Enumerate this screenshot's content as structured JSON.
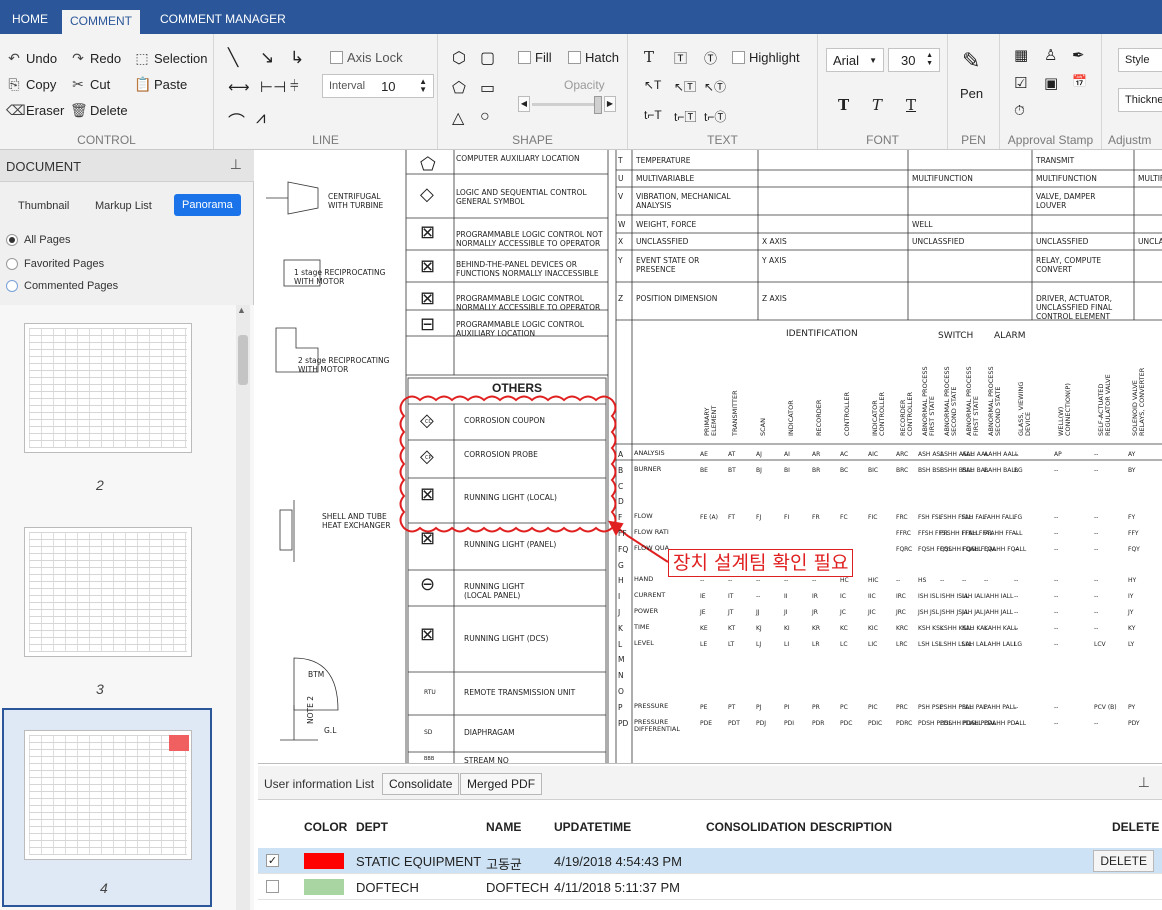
{
  "tabs": [
    "HOME",
    "COMMENT",
    "COMMENT MANAGER"
  ],
  "active_tab": "COMMENT",
  "ribbon": {
    "control": {
      "title": "CONTROL",
      "undo": "Undo",
      "redo": "Redo",
      "selection": "Selection",
      "copy": "Copy",
      "cut": "Cut",
      "paste": "Paste",
      "eraser": "Eraser",
      "delete": "Delete"
    },
    "line": {
      "title": "LINE",
      "axis_lock": "Axis Lock",
      "interval_label": "Interval",
      "interval_value": "10"
    },
    "shape": {
      "title": "SHAPE",
      "fill": "Fill",
      "hatch": "Hatch",
      "opacity": "Opacity"
    },
    "text": {
      "title": "TEXT",
      "highlight": "Highlight"
    },
    "font": {
      "title": "FONT",
      "family": "Arial",
      "size": "30"
    },
    "pen": {
      "title": "PEN",
      "label": "Pen"
    },
    "approval": {
      "title": "Approval Stamp"
    },
    "adjust": {
      "title": "Adjustm",
      "style": "Style",
      "thickness": "Thicknes"
    }
  },
  "document_panel": {
    "title": "DOCUMENT",
    "subtabs": [
      "Thumbnail",
      "Markup List",
      "Panorama"
    ],
    "active_subtab": "Panorama",
    "filters": [
      "All Pages",
      "Favorited Pages",
      "Commented Pages"
    ],
    "selected_filter": "All Pages",
    "pages": [
      "2",
      "3",
      "4"
    ]
  },
  "drawing": {
    "equipment_labels": [
      "CENTRIFUGAL\nWITH TURBINE",
      "1 stage RECIPROCATING\nWITH MOTOR",
      "2 stage RECIPROCATING\nWITH MOTOR",
      "SHELL AND TUBE\nHEAT EXCHANGER",
      "BTM",
      "NOTE 2",
      "G.L"
    ],
    "symbol_rows": [
      "COMPUTER AUXILIARY LOCATION",
      "LOGIC AND SEQUENTIAL CONTROL\nGENERAL SYMBOL",
      "PROGRAMMABLE LOGIC CONTROL NOT\nNORMALLY ACCESSIBLE TO OPERATOR",
      "BEHIND-THE-PANEL DEVICES OR\nFUNCTIONS NORMALLY INACCESSIBLE",
      "PROGRAMMABLE LOGIC CONTROL\nNORMALLY ACCESSIBLE TO OPERATOR",
      "PROGRAMMABLE LOGIC CONTROL\nAUXILIARY LOCATION"
    ],
    "others_title": "OTHERS",
    "others_rows": [
      "CORROSION COUPON",
      "CORROSION PROBE",
      "RUNNING LIGHT (LOCAL)",
      "RUNNING LIGHT (PANEL)",
      "RUNNING LIGHT\n(LOCAL PANEL)",
      "RUNNING LIGHT (DCS)",
      "REMOTE TRANSMISSION UNIT",
      "DIAPHRAGAM",
      "STREAM NO"
    ],
    "others_symbols": [
      "CC",
      "CP",
      "RTU",
      "SD",
      "BBB"
    ],
    "letter_rows": [
      {
        "letter": "T",
        "first": "TEMPERATURE",
        "c3": "",
        "c4": "",
        "c5": "TRANSMIT",
        "c6": ""
      },
      {
        "letter": "U",
        "first": "MULTIVARIABLE",
        "c3": "",
        "c4": "MULTIFUNCTION",
        "c5": "MULTIFUNCTION",
        "c6": "MULTIF"
      },
      {
        "letter": "V",
        "first": "VIBRATION, MECHANICAL\nANALYSIS",
        "c3": "",
        "c4": "",
        "c5": "VALVE, DAMPER\nLOUVER",
        "c6": ""
      },
      {
        "letter": "W",
        "first": "WEIGHT, FORCE",
        "c3": "",
        "c4": "WELL",
        "c5": "",
        "c6": ""
      },
      {
        "letter": "X",
        "first": "UNCLASSFIED",
        "c3": "X AXIS",
        "c4": "UNCLASSFIED",
        "c5": "UNCLASSFIED",
        "c6": "UNCLA"
      },
      {
        "letter": "Y",
        "first": "EVENT STATE OR\nPRESENCE",
        "c3": "Y AXIS",
        "c4": "",
        "c5": "RELAY, COMPUTE\nCONVERT",
        "c6": ""
      },
      {
        "letter": "Z",
        "first": "POSITION DIMENSION",
        "c3": "Z AXIS",
        "c4": "",
        "c5": "DRIVER, ACTUATOR,\nUNCLASSFIED FINAL\nCONTROL ELEMENT",
        "c6": ""
      }
    ],
    "ident_header": "IDENTIFICATION",
    "switch_header": "SWITCH",
    "alarm_header": "ALARM",
    "ident_columns": [
      "PRIMARY\nELEMENT",
      "TRANSMITTER",
      "SCAN",
      "INDICATOR",
      "RECORDER",
      "CONTROLLER",
      "INDICATOR\nCONTROLLER",
      "RECORDER\nCONTROLLER",
      "ABNORMAL PROCESS\nFIRST STATE",
      "ABNORMAL PROCESS\nSECOND STATE",
      "ABNORMAL PROCESS\nFIRST STATE",
      "ABNORMAL PROCESS\nSECOND STATE",
      "GLASS, VIEWING\nDEVICE",
      "WELL(W)\nCONNECTION(P)",
      "SELF-ACTUATED\nREGULATOR VALVE",
      "SOLENOID VALVE\nRELAYS, CONVERTER"
    ],
    "ident_rows": [
      {
        "letter": "A",
        "name": "ANALYSIS",
        "vals": [
          "AE",
          "AT",
          "AJ",
          "AI",
          "AR",
          "AC",
          "AIC",
          "ARC",
          "ASH ASL",
          "ASHH ASLL",
          "AAH AAL",
          "AAHH AALL",
          "--",
          "AP",
          "--",
          "AY"
        ]
      },
      {
        "letter": "B",
        "name": "BURNER",
        "vals": [
          "BE",
          "BT",
          "BJ",
          "BI",
          "BR",
          "BC",
          "BIC",
          "BRC",
          "BSH BSL",
          "BSHH BSLL",
          "BAH BAL",
          "BAHH BALL",
          "BG",
          "--",
          "--",
          "BY"
        ]
      },
      {
        "letter": "C",
        "name": "",
        "vals": []
      },
      {
        "letter": "D",
        "name": "",
        "vals": []
      },
      {
        "letter": "F",
        "name": "FLOW",
        "vals": [
          "FE (A)",
          "FT",
          "FJ",
          "FI",
          "FR",
          "FC",
          "FIC",
          "FRC",
          "FSH FSL",
          "FSHH FSLL",
          "FAH FAL",
          "FAHH FALL",
          "FG",
          "--",
          "--",
          "FY"
        ]
      },
      {
        "letter": "FF",
        "name": "FLOW RATI",
        "vals": [
          "",
          "",
          "",
          "",
          "",
          "",
          "",
          "FFRC",
          "FFSH FFSL",
          "FFSHH FFSLL",
          "FFAH FFAL",
          "FFAHH FFALL",
          "--",
          "--",
          "--",
          "FFY"
        ]
      },
      {
        "letter": "FQ",
        "name": "FLOW QUA",
        "vals": [
          "",
          "",
          "",
          "",
          "",
          "",
          "",
          "FQRC",
          "FQSH FQSL",
          "FQSHH FQSLL",
          "FQAH FQAL",
          "FQAHH FQALL",
          "--",
          "--",
          "--",
          "FQY"
        ]
      },
      {
        "letter": "G",
        "name": "",
        "vals": []
      },
      {
        "letter": "H",
        "name": "HAND",
        "vals": [
          "--",
          "--",
          "--",
          "--",
          "--",
          "HC",
          "HIC",
          "--",
          "HS",
          "--",
          "--",
          "--",
          "--",
          "--",
          "--",
          "HY"
        ]
      },
      {
        "letter": "I",
        "name": "CURRENT",
        "vals": [
          "IE",
          "IT",
          "--",
          "II",
          "IR",
          "IC",
          "IIC",
          "IRC",
          "ISH ISL",
          "ISHH ISLL",
          "IAH IAL",
          "IAHH IALL",
          "--",
          "--",
          "--",
          "IY"
        ]
      },
      {
        "letter": "J",
        "name": "POWER",
        "vals": [
          "JE",
          "JT",
          "JJ",
          "JI",
          "JR",
          "JC",
          "JIC",
          "JRC",
          "JSH JSL",
          "JSHH JSLL",
          "JAH JAL",
          "JAHH JALL",
          "--",
          "--",
          "--",
          "JY"
        ]
      },
      {
        "letter": "K",
        "name": "TIME",
        "vals": [
          "KE",
          "KT",
          "KJ",
          "KI",
          "KR",
          "KC",
          "KIC",
          "KRC",
          "KSH KSL",
          "KSHH KSLL",
          "KAH KAL",
          "KAHH KALL",
          "--",
          "--",
          "--",
          "KY"
        ]
      },
      {
        "letter": "L",
        "name": "LEVEL",
        "vals": [
          "LE",
          "LT",
          "LJ",
          "LI",
          "LR",
          "LC",
          "LIC",
          "LRC",
          "LSH LSL",
          "LSHH LSLL",
          "LAH LAL",
          "LAHH LALL",
          "LG",
          "--",
          "LCV",
          "LY"
        ]
      },
      {
        "letter": "M",
        "name": "",
        "vals": []
      },
      {
        "letter": "N",
        "name": "",
        "vals": []
      },
      {
        "letter": "O",
        "name": "",
        "vals": []
      },
      {
        "letter": "P",
        "name": "PRESSURE",
        "vals": [
          "PE",
          "PT",
          "PJ",
          "PI",
          "PR",
          "PC",
          "PIC",
          "PRC",
          "PSH PSL",
          "PSHH PSLL",
          "PAH PAL",
          "PAHH PALL",
          "--",
          "--",
          "PCV (B)",
          "PY"
        ]
      },
      {
        "letter": "PD",
        "name": "PRESSURE\nDIFFERENTIAL",
        "vals": [
          "PDE",
          "PDT",
          "PDJ",
          "PDI",
          "PDR",
          "PDC",
          "PDIC",
          "PDRC",
          "PDSH PDSL",
          "PDSHH PDSLL",
          "PDAH PDAL",
          "PDAHH PDALL",
          "--",
          "--",
          "--",
          "PDY"
        ]
      }
    ],
    "annotation": "장치 설계팀 확인 필요"
  },
  "user_panel": {
    "title": "User information List",
    "btn_consolidate": "Consolidate",
    "btn_merged": "Merged PDF",
    "columns": [
      "COLOR",
      "DEPT",
      "NAME",
      "UPDATETIME",
      "CONSOLIDATION",
      "DESCRIPTION",
      "DELETE"
    ],
    "rows": [
      {
        "checked": true,
        "color": "#ff0000",
        "dept": "STATIC EQUIPMENT",
        "name": "고동균",
        "updatetime": "4/19/2018 4:54:43 PM",
        "consolidation": "",
        "description": "",
        "delete": "DELETE"
      },
      {
        "checked": false,
        "color": "#a8d5a2",
        "dept": "DOFTECH",
        "name": "DOFTECH",
        "updatetime": "4/11/2018 5:11:37 PM",
        "consolidation": "",
        "description": "",
        "delete": ""
      }
    ]
  },
  "colors": {
    "ribbon_blue": "#2b579a",
    "markup_red": "#e02020",
    "selection_blue": "#cde3f5"
  }
}
